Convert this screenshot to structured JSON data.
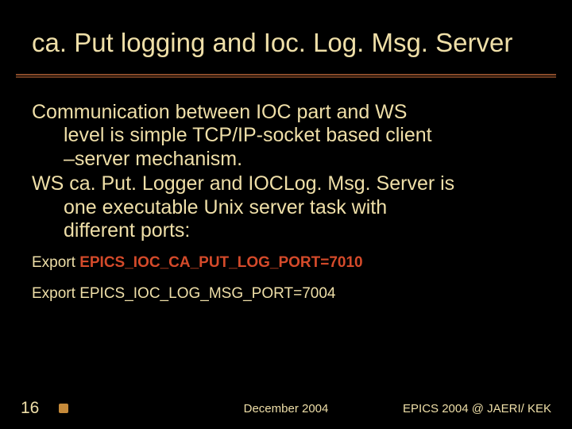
{
  "title": "ca. Put logging and Ioc. Log. Msg. Server",
  "body": {
    "para1_line1": "Communication between IOC part and WS",
    "para1_line2": "level is simple TCP/IP-socket based client",
    "para1_line3": "–server mechanism.",
    "para2_line1": "WS ca. Put. Logger and IOCLog. Msg. Server is",
    "para2_line2": "one executable Unix server task with",
    "para2_line3": "different ports:"
  },
  "exports": {
    "line1_prefix": "Export ",
    "line1_value": "EPICS_IOC_CA_PUT_LOG_PORT=7010",
    "line2_full": "Export  EPICS_IOC_LOG_MSG_PORT=7004"
  },
  "footer": {
    "page": "16",
    "date": "December 2004",
    "venue": "EPICS 2004 @ JAERI/ KEK"
  }
}
